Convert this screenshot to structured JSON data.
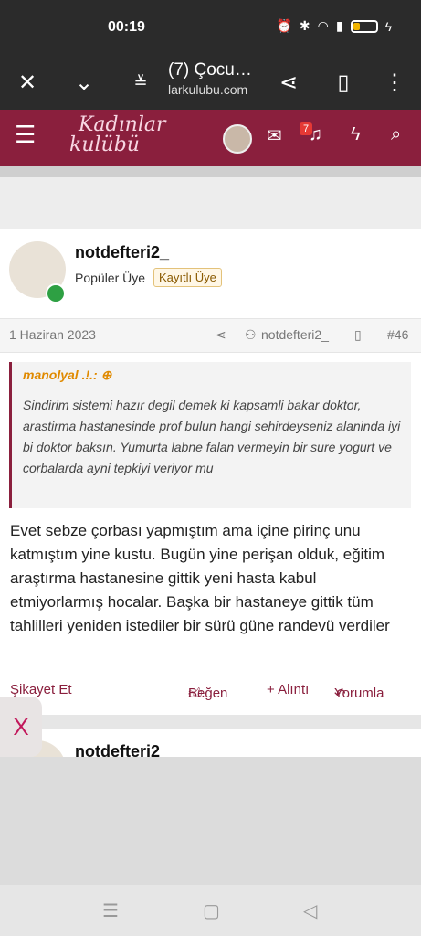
{
  "status": {
    "time": "00:19"
  },
  "browser": {
    "tab_title": "(7) Çocu…",
    "url": "larkulubu.com"
  },
  "site": {
    "logo_line1": "Kadınlar",
    "logo_line2": "kulübü",
    "notif_count": "7"
  },
  "post": {
    "username": "notdefteri2_",
    "role": "Popüler Üye",
    "badge": "Kayıtlı Üye",
    "date": "1 Haziran 2023",
    "meta_user": "notdefteri2_",
    "post_number": "#46",
    "quote_author": "manolyal .!.:",
    "quote_text": "Sindirim sistemi hazır degil demek ki kapsamli bakar doktor, arastirma hastanesinde prof bulun hangi sehirdeyseniz alaninda iyi bi doktor baksın. Yumurta labne falan vermeyin bir sure yogurt ve corbalarda ayni tepkiyi veriyor mu",
    "body": "Evet sebze çorbası yapmıştım ama içine pirinç unu katmıştım yine kustu. Bugün yine perişan olduk, eğitim araştırma hastanesine gittik yeni hasta kabul etmiyorlarmış hocalar. Başka bir hastaneye gittik tüm tahlilleri yeniden istediler bir sürü güne randevü verdiler",
    "report": "Şikayet Et",
    "like": "Beğen",
    "quote_btn": "+ Alıntı",
    "reply": "Yorumla"
  },
  "next_post": {
    "username": "notdefteri2"
  },
  "close_tab_label": "X"
}
